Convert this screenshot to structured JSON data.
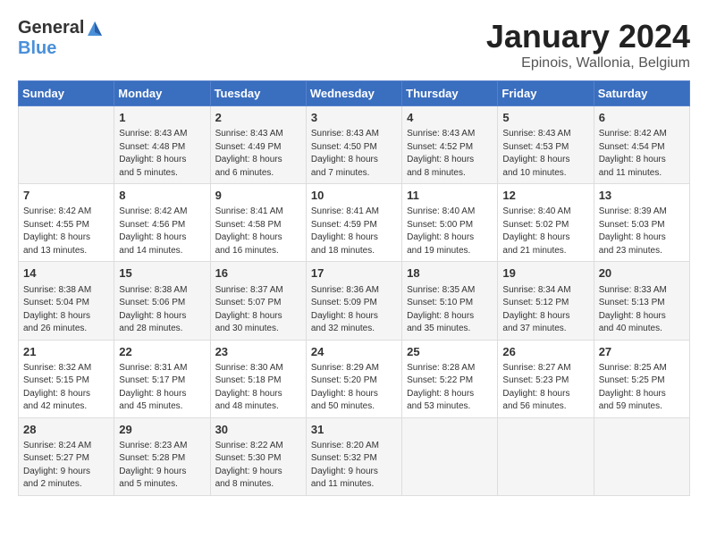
{
  "header": {
    "logo_general": "General",
    "logo_blue": "Blue",
    "month_title": "January 2024",
    "subtitle": "Epinois, Wallonia, Belgium"
  },
  "days_of_week": [
    "Sunday",
    "Monday",
    "Tuesday",
    "Wednesday",
    "Thursday",
    "Friday",
    "Saturday"
  ],
  "weeks": [
    [
      {
        "day": "",
        "info": ""
      },
      {
        "day": "1",
        "info": "Sunrise: 8:43 AM\nSunset: 4:48 PM\nDaylight: 8 hours\nand 5 minutes."
      },
      {
        "day": "2",
        "info": "Sunrise: 8:43 AM\nSunset: 4:49 PM\nDaylight: 8 hours\nand 6 minutes."
      },
      {
        "day": "3",
        "info": "Sunrise: 8:43 AM\nSunset: 4:50 PM\nDaylight: 8 hours\nand 7 minutes."
      },
      {
        "day": "4",
        "info": "Sunrise: 8:43 AM\nSunset: 4:52 PM\nDaylight: 8 hours\nand 8 minutes."
      },
      {
        "day": "5",
        "info": "Sunrise: 8:43 AM\nSunset: 4:53 PM\nDaylight: 8 hours\nand 10 minutes."
      },
      {
        "day": "6",
        "info": "Sunrise: 8:42 AM\nSunset: 4:54 PM\nDaylight: 8 hours\nand 11 minutes."
      }
    ],
    [
      {
        "day": "7",
        "info": "Sunrise: 8:42 AM\nSunset: 4:55 PM\nDaylight: 8 hours\nand 13 minutes."
      },
      {
        "day": "8",
        "info": "Sunrise: 8:42 AM\nSunset: 4:56 PM\nDaylight: 8 hours\nand 14 minutes."
      },
      {
        "day": "9",
        "info": "Sunrise: 8:41 AM\nSunset: 4:58 PM\nDaylight: 8 hours\nand 16 minutes."
      },
      {
        "day": "10",
        "info": "Sunrise: 8:41 AM\nSunset: 4:59 PM\nDaylight: 8 hours\nand 18 minutes."
      },
      {
        "day": "11",
        "info": "Sunrise: 8:40 AM\nSunset: 5:00 PM\nDaylight: 8 hours\nand 19 minutes."
      },
      {
        "day": "12",
        "info": "Sunrise: 8:40 AM\nSunset: 5:02 PM\nDaylight: 8 hours\nand 21 minutes."
      },
      {
        "day": "13",
        "info": "Sunrise: 8:39 AM\nSunset: 5:03 PM\nDaylight: 8 hours\nand 23 minutes."
      }
    ],
    [
      {
        "day": "14",
        "info": "Sunrise: 8:38 AM\nSunset: 5:04 PM\nDaylight: 8 hours\nand 26 minutes."
      },
      {
        "day": "15",
        "info": "Sunrise: 8:38 AM\nSunset: 5:06 PM\nDaylight: 8 hours\nand 28 minutes."
      },
      {
        "day": "16",
        "info": "Sunrise: 8:37 AM\nSunset: 5:07 PM\nDaylight: 8 hours\nand 30 minutes."
      },
      {
        "day": "17",
        "info": "Sunrise: 8:36 AM\nSunset: 5:09 PM\nDaylight: 8 hours\nand 32 minutes."
      },
      {
        "day": "18",
        "info": "Sunrise: 8:35 AM\nSunset: 5:10 PM\nDaylight: 8 hours\nand 35 minutes."
      },
      {
        "day": "19",
        "info": "Sunrise: 8:34 AM\nSunset: 5:12 PM\nDaylight: 8 hours\nand 37 minutes."
      },
      {
        "day": "20",
        "info": "Sunrise: 8:33 AM\nSunset: 5:13 PM\nDaylight: 8 hours\nand 40 minutes."
      }
    ],
    [
      {
        "day": "21",
        "info": "Sunrise: 8:32 AM\nSunset: 5:15 PM\nDaylight: 8 hours\nand 42 minutes."
      },
      {
        "day": "22",
        "info": "Sunrise: 8:31 AM\nSunset: 5:17 PM\nDaylight: 8 hours\nand 45 minutes."
      },
      {
        "day": "23",
        "info": "Sunrise: 8:30 AM\nSunset: 5:18 PM\nDaylight: 8 hours\nand 48 minutes."
      },
      {
        "day": "24",
        "info": "Sunrise: 8:29 AM\nSunset: 5:20 PM\nDaylight: 8 hours\nand 50 minutes."
      },
      {
        "day": "25",
        "info": "Sunrise: 8:28 AM\nSunset: 5:22 PM\nDaylight: 8 hours\nand 53 minutes."
      },
      {
        "day": "26",
        "info": "Sunrise: 8:27 AM\nSunset: 5:23 PM\nDaylight: 8 hours\nand 56 minutes."
      },
      {
        "day": "27",
        "info": "Sunrise: 8:25 AM\nSunset: 5:25 PM\nDaylight: 8 hours\nand 59 minutes."
      }
    ],
    [
      {
        "day": "28",
        "info": "Sunrise: 8:24 AM\nSunset: 5:27 PM\nDaylight: 9 hours\nand 2 minutes."
      },
      {
        "day": "29",
        "info": "Sunrise: 8:23 AM\nSunset: 5:28 PM\nDaylight: 9 hours\nand 5 minutes."
      },
      {
        "day": "30",
        "info": "Sunrise: 8:22 AM\nSunset: 5:30 PM\nDaylight: 9 hours\nand 8 minutes."
      },
      {
        "day": "31",
        "info": "Sunrise: 8:20 AM\nSunset: 5:32 PM\nDaylight: 9 hours\nand 11 minutes."
      },
      {
        "day": "",
        "info": ""
      },
      {
        "day": "",
        "info": ""
      },
      {
        "day": "",
        "info": ""
      }
    ]
  ]
}
